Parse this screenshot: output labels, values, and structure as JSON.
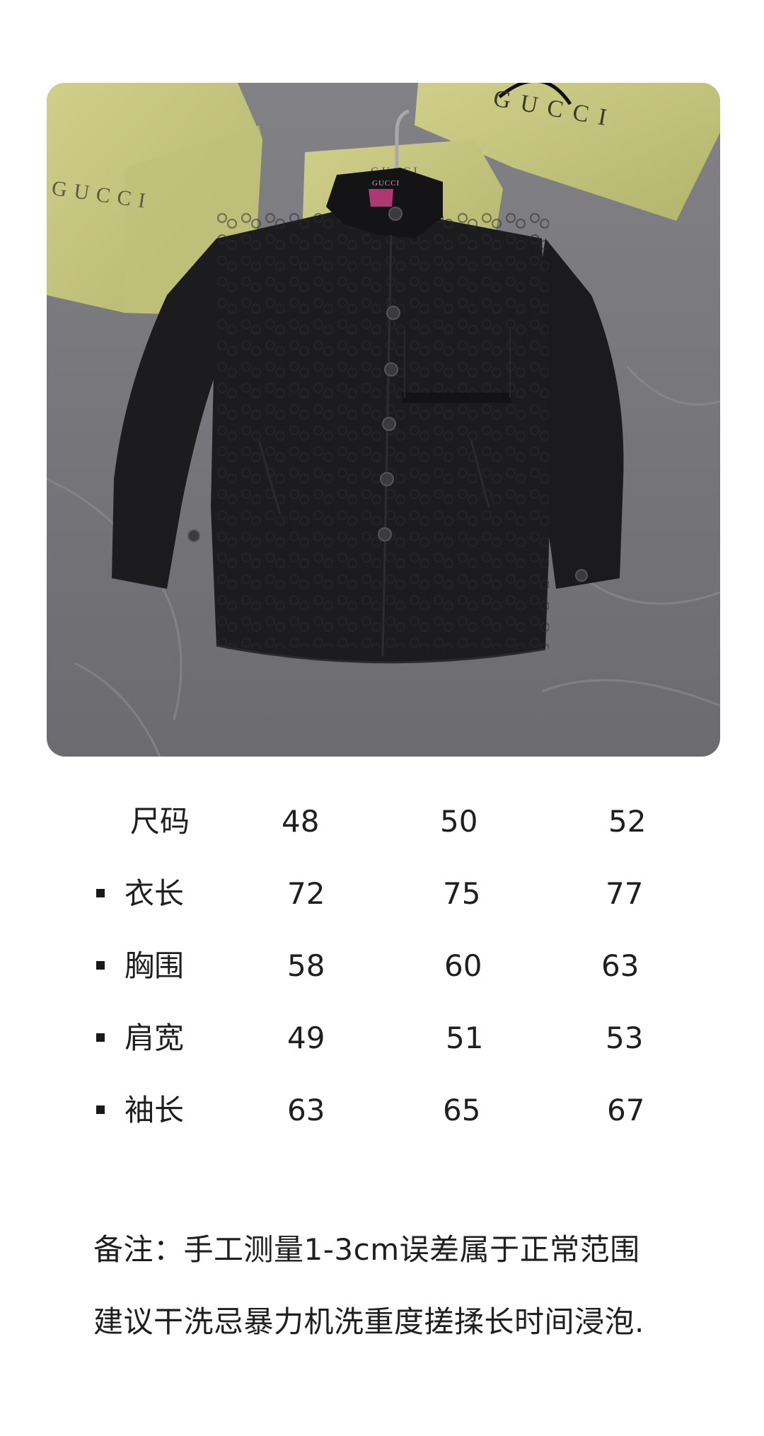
{
  "product_photo": {
    "alt": "Black GG monogram long-sleeve snap-button shirt with Gucci boxes and bags",
    "brand_marks": [
      "GUCCI",
      "GUCCI",
      "GUCCI",
      "GUCCI"
    ],
    "colors": {
      "backdrop": "#77777a",
      "shirt": "#1c1c1e",
      "box_yellow": "#c6c77e",
      "collar_label": "#b03872"
    }
  },
  "size_table": {
    "header": {
      "label": "尺码",
      "values": [
        "48",
        "50",
        "52"
      ]
    },
    "rows": [
      {
        "label": "衣长",
        "values": [
          "72",
          "75",
          "77"
        ]
      },
      {
        "label": "胸围",
        "values": [
          "58",
          "60",
          "63"
        ]
      },
      {
        "label": "肩宽",
        "values": [
          "49",
          "51",
          "53"
        ]
      },
      {
        "label": "袖长",
        "values": [
          "63",
          "65",
          "67"
        ]
      }
    ]
  },
  "notes": {
    "line1": "备注：手工测量1-3cm误差属于正常范围",
    "line2": "建议干洗忌暴力机洗重度搓揉长时间浸泡."
  }
}
